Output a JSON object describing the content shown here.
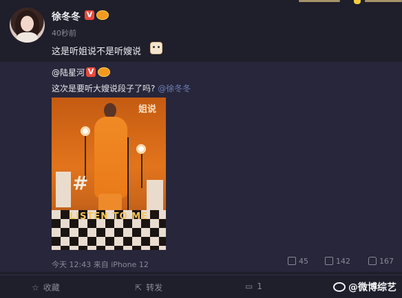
{
  "post": {
    "username": "徐冬冬",
    "timestamp": "40秒前",
    "text": "这是听姐说不是听嫂说"
  },
  "repost": {
    "username": "@陆星河",
    "text": "这次是要听大嫂说段子了吗?",
    "mention": "@徐冬冬",
    "poster": {
      "tagline": "LISTEN TO ME",
      "hash": "#",
      "logo": "姐说"
    },
    "meta": "今天 12:43 来自 iPhone 12",
    "stats": {
      "repost": "45",
      "comment": "142",
      "like": "167"
    }
  },
  "badges": {
    "verified": "V"
  },
  "actions": {
    "favorite": "收藏",
    "forward": "转发",
    "comment": "1"
  },
  "watermark": "@微博综艺",
  "colors": {
    "background": "#1f1e2b",
    "repost_bg": "#27263a",
    "mention": "#6d80b8",
    "verified": "#f5a623"
  }
}
